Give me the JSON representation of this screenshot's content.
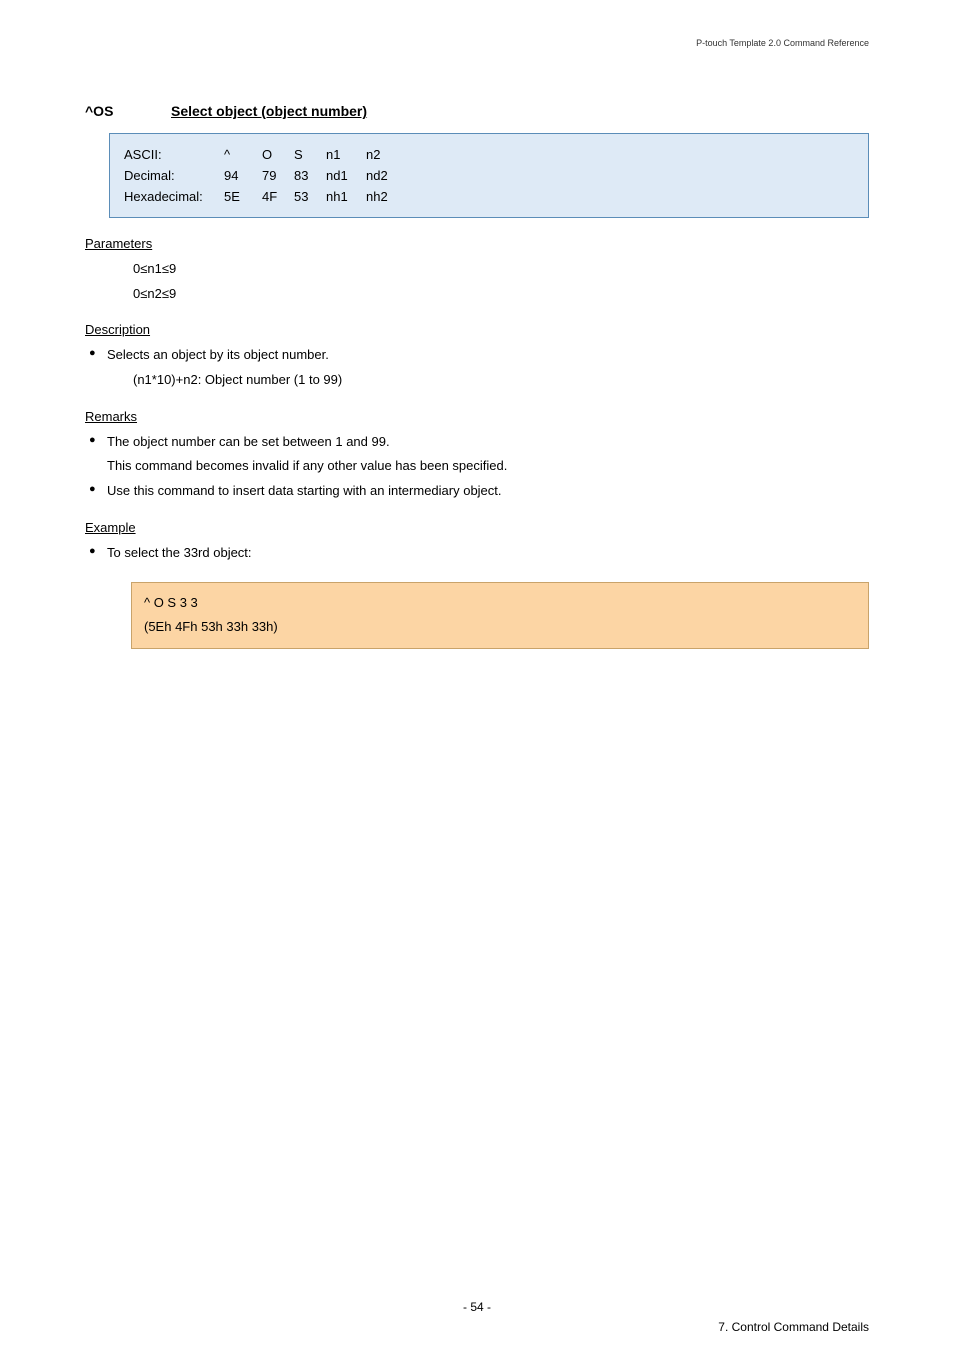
{
  "header": {
    "doc_title": "P-touch Template 2.0 Command Reference"
  },
  "section": {
    "command": "^OS",
    "title": "Select object (object number)"
  },
  "codes": {
    "rows": [
      {
        "label": "ASCII:",
        "c1": "^",
        "c2": "O",
        "c3": "S",
        "c4": "n1",
        "c5": "n2"
      },
      {
        "label": "Decimal:",
        "c1": "94",
        "c2": "79",
        "c3": "83",
        "c4": "nd1",
        "c5": "nd2"
      },
      {
        "label": "Hexadecimal:",
        "c1": "5E",
        "c2": "4F",
        "c3": "53",
        "c4": "nh1",
        "c5": "nh2"
      }
    ]
  },
  "parameters": {
    "heading": "Parameters",
    "lines": [
      "0≤n1≤9",
      "0≤n2≤9"
    ]
  },
  "description": {
    "heading": "Description",
    "bullet": "Selects an object by its object number.",
    "subline": "(n1*10)+n2:   Object number (1 to 99)"
  },
  "remarks": {
    "heading": "Remarks",
    "items": [
      {
        "text": "The object number can be set between 1 and 99.",
        "sub": "This command becomes invalid if any other value has been specified."
      },
      {
        "text": "Use this command to insert data starting with an intermediary object."
      }
    ]
  },
  "example": {
    "heading": "Example",
    "bullet": "To select the 33rd object:",
    "box_line1": "^ O S 3 3",
    "box_line2": "(5Eh 4Fh 53h 33h 33h)"
  },
  "footer": {
    "page": "- 54 -",
    "chapter": "7. Control Command Details"
  }
}
